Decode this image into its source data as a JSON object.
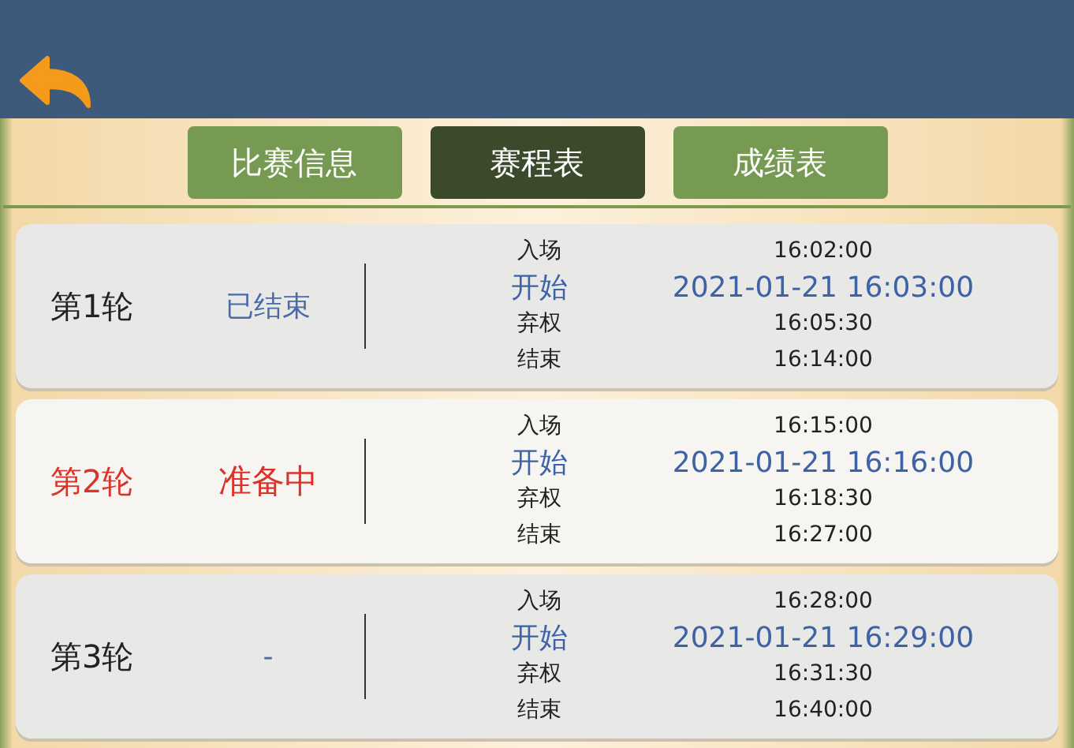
{
  "header": {
    "back_button": true
  },
  "tabs": [
    {
      "label": "比赛信息",
      "selected": false
    },
    {
      "label": "赛程表",
      "selected": true
    },
    {
      "label": "成绩表",
      "selected": false
    }
  ],
  "rounds": [
    {
      "name": "第1轮",
      "status": "已结束",
      "kind": "finished",
      "schedule": [
        {
          "label": "入场",
          "time": "16:02:00",
          "emphasized": false
        },
        {
          "label": "开始",
          "time": "2021-01-21 16:03:00",
          "emphasized": true
        },
        {
          "label": "弃权",
          "time": "16:05:30",
          "emphasized": false
        },
        {
          "label": "结束",
          "time": "16:14:00",
          "emphasized": false
        }
      ]
    },
    {
      "name": "第2轮",
      "status": "准备中",
      "kind": "current",
      "schedule": [
        {
          "label": "入场",
          "time": "16:15:00",
          "emphasized": false
        },
        {
          "label": "开始",
          "time": "2021-01-21 16:16:00",
          "emphasized": true
        },
        {
          "label": "弃权",
          "time": "16:18:30",
          "emphasized": false
        },
        {
          "label": "结束",
          "time": "16:27:00",
          "emphasized": false
        }
      ]
    },
    {
      "name": "第3轮",
      "status": "-",
      "kind": "pending",
      "schedule": [
        {
          "label": "入场",
          "time": "16:28:00",
          "emphasized": false
        },
        {
          "label": "开始",
          "time": "2021-01-21 16:29:00",
          "emphasized": true
        },
        {
          "label": "弃权",
          "time": "16:31:30",
          "emphasized": false
        },
        {
          "label": "结束",
          "time": "16:40:00",
          "emphasized": false
        }
      ]
    }
  ]
}
